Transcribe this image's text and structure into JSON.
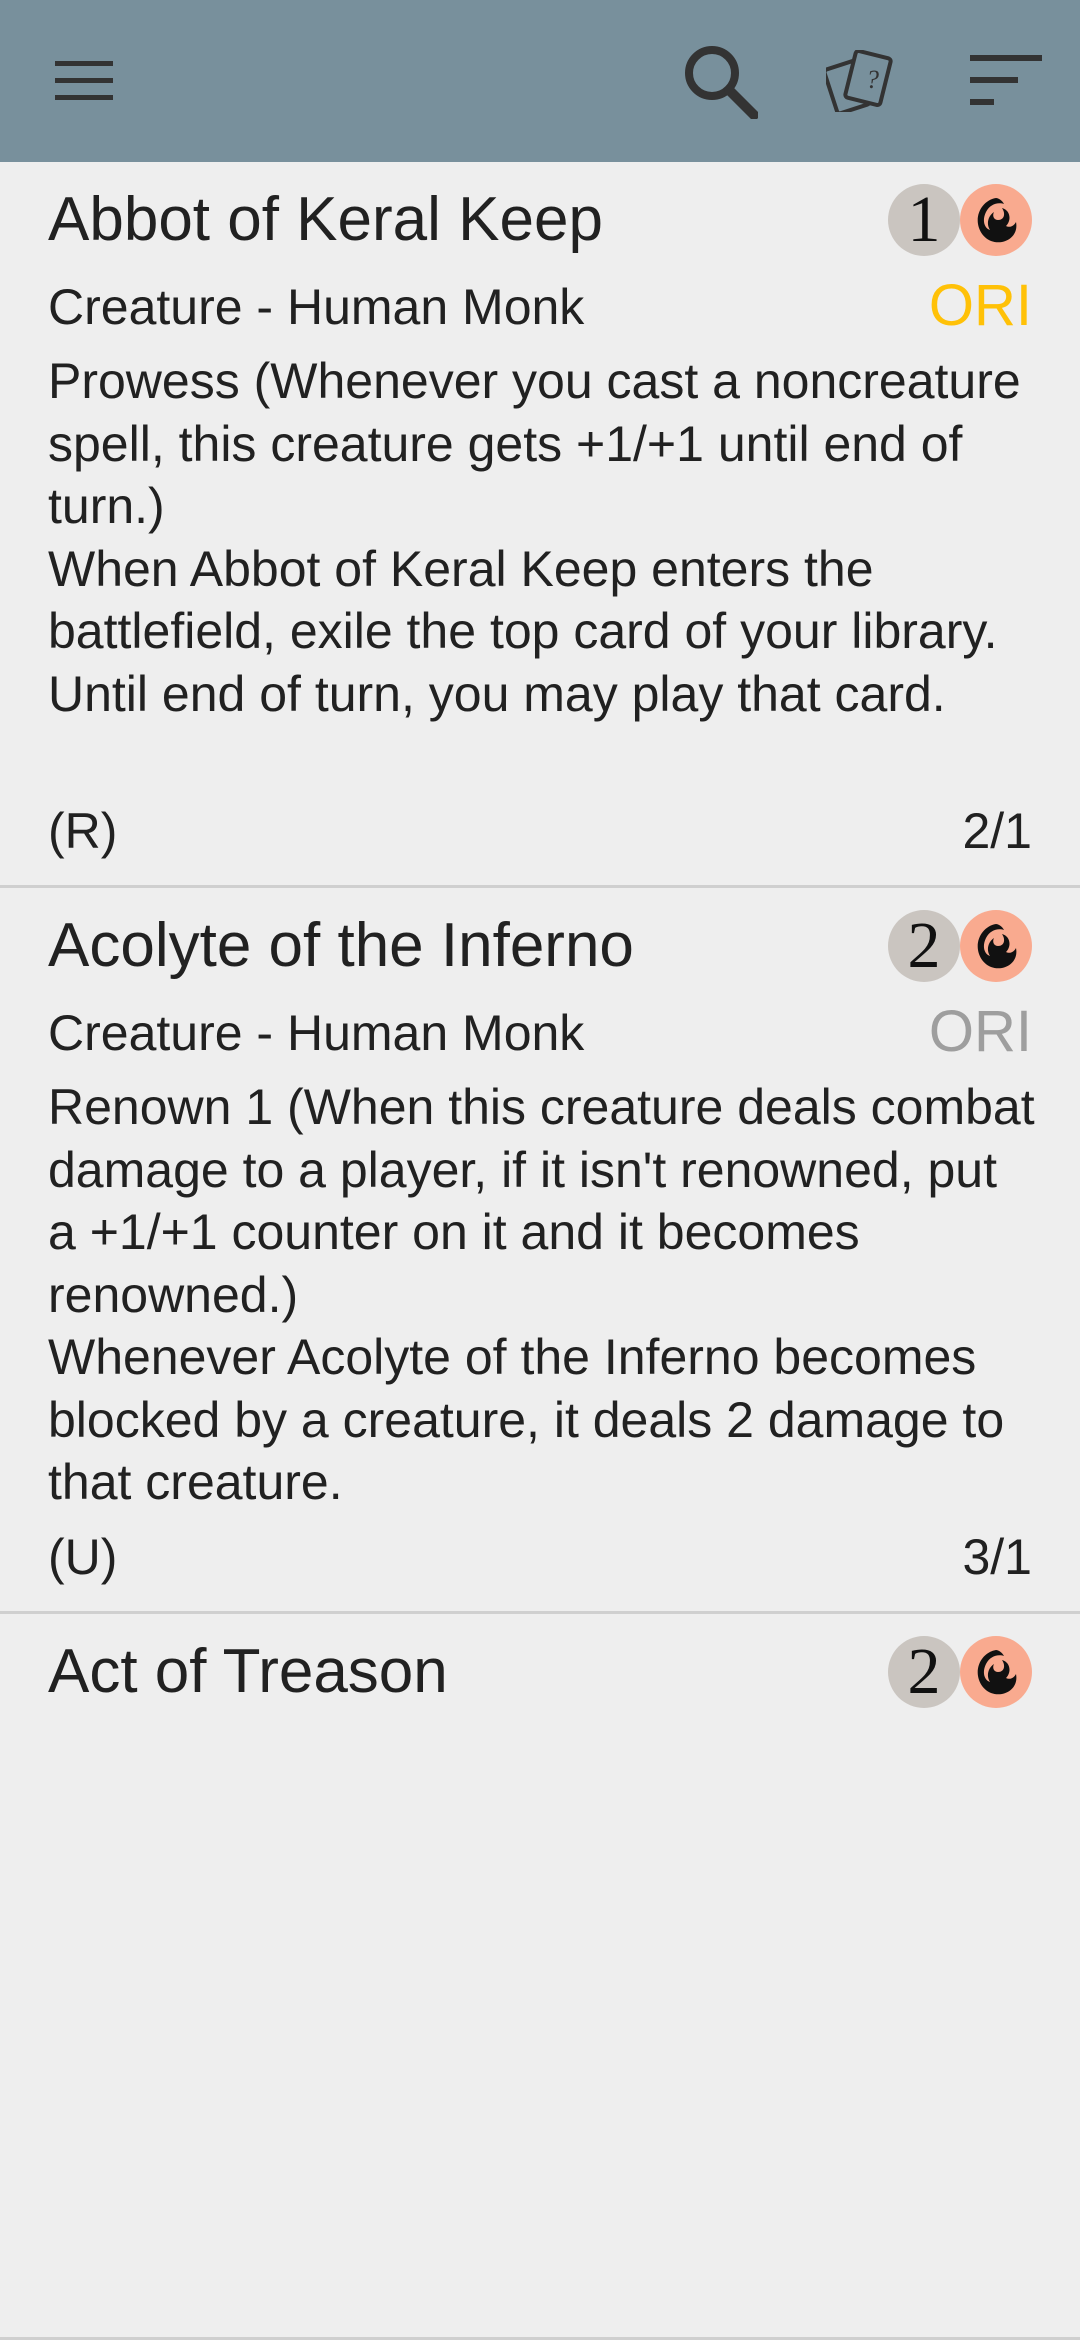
{
  "toolbar": {
    "icons": [
      "menu-icon",
      "search-icon",
      "random-cards-icon",
      "sort-icon"
    ],
    "background": "#78909c"
  },
  "cards": [
    {
      "name": "Abbot of Keral Keep",
      "cost": {
        "generic": "1",
        "colored": "red"
      },
      "type": "Creature - Human Monk",
      "set": "ORI",
      "set_color": "#ffc107",
      "text": [
        "Prowess (Whenever you cast a noncreature spell, this creature gets +1/+1 until end of turn.)",
        "When Abbot of Keral Keep enters the battlefield, exile the top card of your library. Until end of turn, you may play that card."
      ],
      "rarity": "(R)",
      "pt": "2/1"
    },
    {
      "name": "Acolyte of the Inferno",
      "cost": {
        "generic": "2",
        "colored": "red"
      },
      "type": "Creature - Human Monk",
      "set": "ORI",
      "set_color": "#9e9e9e",
      "text": [
        "Renown 1 (When this creature deals combat damage to a player, if it isn't renowned, put a +1/+1 counter on it and it becomes renowned.)",
        "Whenever Acolyte of the Inferno becomes blocked by a creature, it deals 2 damage to that creature."
      ],
      "rarity": "(U)",
      "pt": "3/1"
    },
    {
      "name": "Act of Treason",
      "cost": {
        "generic": "2",
        "colored": "red"
      }
    }
  ]
}
